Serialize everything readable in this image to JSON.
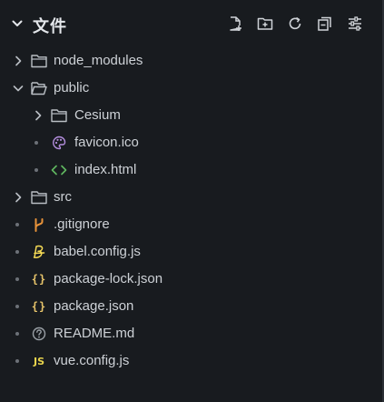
{
  "panel": {
    "title": "文件",
    "tools": [
      "new-file",
      "new-folder",
      "refresh",
      "collapse-all",
      "settings"
    ]
  },
  "tree": {
    "node_modules": "node_modules",
    "public": "public",
    "cesium": "Cesium",
    "favicon": "favicon.ico",
    "index_html": "index.html",
    "src": "src",
    "gitignore": ".gitignore",
    "babel": "babel.config.js",
    "package_lock": "package-lock.json",
    "package_json": "package.json",
    "readme": "README.md",
    "vue_config": "vue.config.js"
  },
  "icons": {
    "js_badge": "JS",
    "json_braces": "{}"
  },
  "colors": {
    "background": "#181b1f",
    "text": "#cdd1d6",
    "icon": "#cfd3d8",
    "git": "#e8933a",
    "babel": "#f5da55",
    "json": "#e8c56b",
    "html": "#5fb55f",
    "favicon": "#b48ede",
    "readme": "#9aa0a6"
  }
}
